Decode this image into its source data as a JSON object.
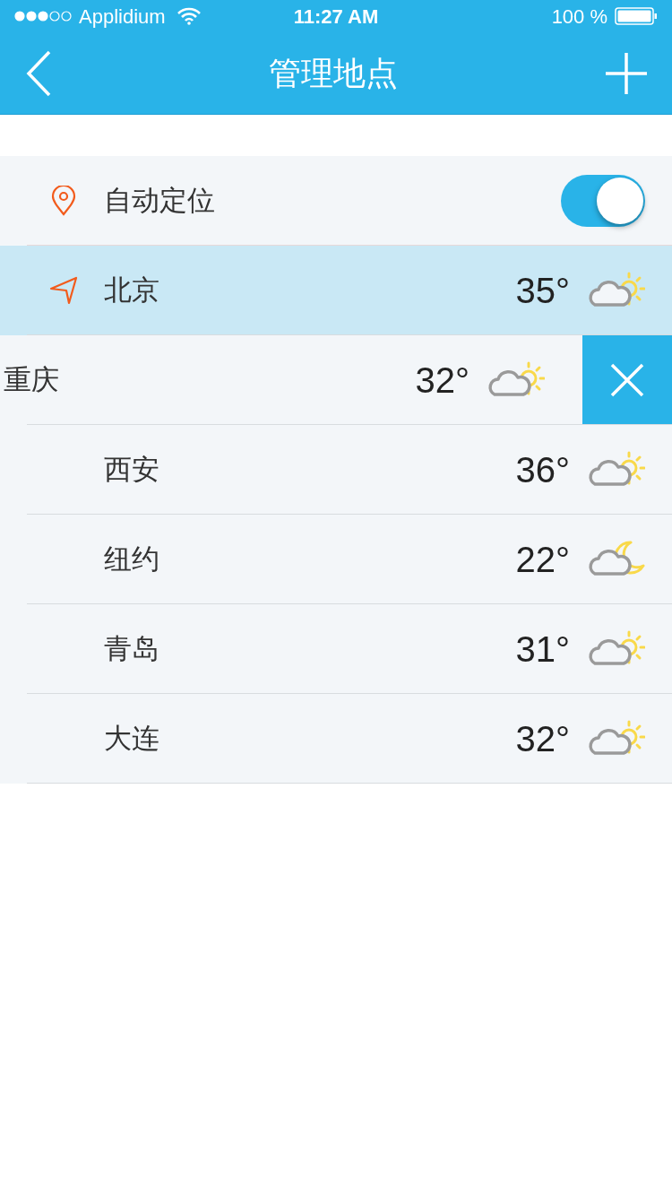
{
  "status_bar": {
    "carrier": "Applidium",
    "time": "11:27 AM",
    "battery": "100 %"
  },
  "nav": {
    "title": "管理地点"
  },
  "auto_locate": {
    "label": "自动定位",
    "on": true
  },
  "cities": [
    {
      "name": "北京",
      "temp": "35°",
      "kind": "sun",
      "current": true,
      "selected": true,
      "swiped": false
    },
    {
      "name": "重庆",
      "temp": "32°",
      "kind": "sun",
      "current": false,
      "selected": false,
      "swiped": true
    },
    {
      "name": "西安",
      "temp": "36°",
      "kind": "sun",
      "current": false,
      "selected": false,
      "swiped": false
    },
    {
      "name": "纽约",
      "temp": "22°",
      "kind": "moon",
      "current": false,
      "selected": false,
      "swiped": false
    },
    {
      "name": "青岛",
      "temp": "31°",
      "kind": "sun",
      "current": false,
      "selected": false,
      "swiped": false
    },
    {
      "name": "大连",
      "temp": "32°",
      "kind": "sun",
      "current": false,
      "selected": false,
      "swiped": false
    }
  ]
}
